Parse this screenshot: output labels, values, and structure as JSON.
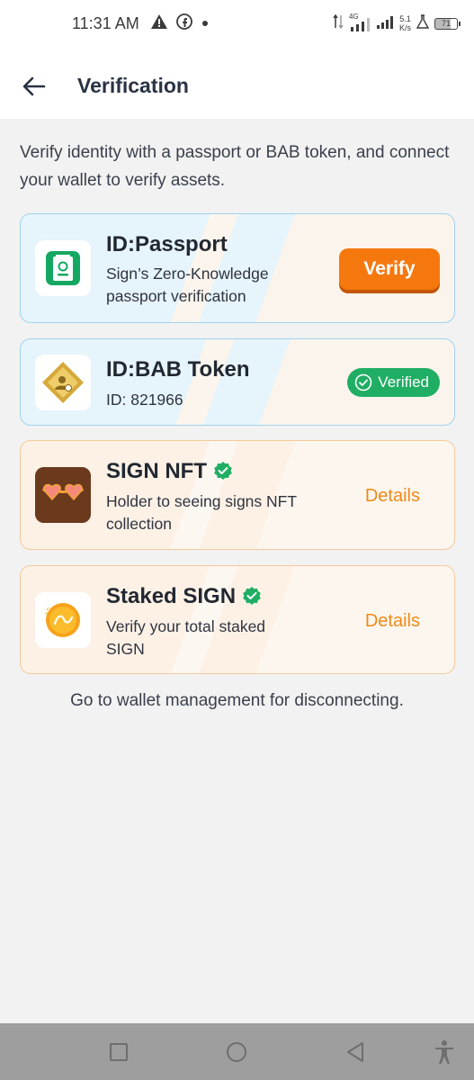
{
  "status_bar": {
    "time": "11:31 AM",
    "network_type": "4G",
    "net_speed_value": "5.1",
    "net_speed_unit": "K/s",
    "battery_level": "71"
  },
  "header": {
    "title": "Verification"
  },
  "intro": {
    "text": "Verify identity with a passport or BAB token, and connect your wallet to verify assets."
  },
  "cards": {
    "passport": {
      "title": "ID:Passport",
      "description": "Sign’s Zero-Knowledge passport verification",
      "action_label": "Verify"
    },
    "bab": {
      "title": "ID:BAB Token",
      "description": "ID: 821966",
      "status_label": "Verified"
    },
    "nft": {
      "title": "SIGN NFT",
      "description": "Holder to seeing signs NFT collection",
      "action_label": "Details"
    },
    "staked": {
      "title": "Staked SIGN",
      "description": "Verify your total staked SIGN",
      "action_label": "Details"
    }
  },
  "footer": {
    "note": "Go to wallet management for disconnecting."
  },
  "colors": {
    "accent_orange": "#f5780f",
    "verified_green": "#1fae63",
    "link_orange": "#ee8a1a"
  }
}
